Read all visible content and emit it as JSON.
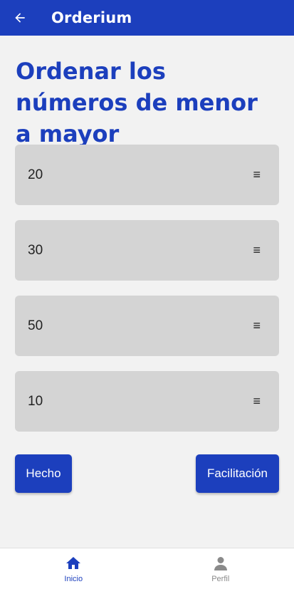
{
  "appbar": {
    "title": "Orderium",
    "back_icon": "arrow-left-icon"
  },
  "page": {
    "heading": "Ordenar los números de menor a mayor"
  },
  "items": [
    {
      "value": "20",
      "handle": "≡"
    },
    {
      "value": "30",
      "handle": "≡"
    },
    {
      "value": "50",
      "handle": "≡"
    },
    {
      "value": "10",
      "handle": "≡"
    }
  ],
  "buttons": {
    "done": "Hecho",
    "help": "Facilitación"
  },
  "bottom_nav": [
    {
      "label": "Inicio",
      "icon": "home-icon",
      "active": true
    },
    {
      "label": "Perfil",
      "icon": "person-icon",
      "active": false
    }
  ],
  "colors": {
    "primary": "#1c3fbd",
    "background": "#f2f2f2",
    "item": "#d4d4d4",
    "inactive": "#8a8a8a"
  }
}
